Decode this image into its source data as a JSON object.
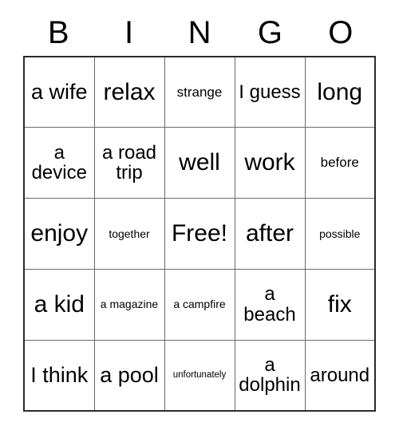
{
  "card": {
    "title_letters": [
      "B",
      "I",
      "N",
      "G",
      "O"
    ],
    "free_space_label": "Free!",
    "rows": [
      [
        {
          "text": "a wife",
          "size": "lg"
        },
        {
          "text": "relax",
          "size": "xl"
        },
        {
          "text": "strange",
          "size": "sm"
        },
        {
          "text": "I guess",
          "size": "md"
        },
        {
          "text": "long",
          "size": "xl"
        }
      ],
      [
        {
          "text": "a device",
          "size": "md"
        },
        {
          "text": "a road trip",
          "size": "md"
        },
        {
          "text": "well",
          "size": "xl"
        },
        {
          "text": "work",
          "size": "xl"
        },
        {
          "text": "before",
          "size": "sm"
        }
      ],
      [
        {
          "text": "enjoy",
          "size": "xl"
        },
        {
          "text": "together",
          "size": "xs"
        },
        {
          "text": "Free!",
          "size": "xl"
        },
        {
          "text": "after",
          "size": "xl"
        },
        {
          "text": "possible",
          "size": "xs"
        }
      ],
      [
        {
          "text": "a kid",
          "size": "xl"
        },
        {
          "text": "a magazine",
          "size": "xs"
        },
        {
          "text": "a campfire",
          "size": "xs"
        },
        {
          "text": "a beach",
          "size": "md"
        },
        {
          "text": "fix",
          "size": "xl"
        }
      ],
      [
        {
          "text": "I think",
          "size": "lg"
        },
        {
          "text": "a pool",
          "size": "lg"
        },
        {
          "text": "unfortunately",
          "size": "xxs"
        },
        {
          "text": "a dolphin",
          "size": "md"
        },
        {
          "text": "around",
          "size": "md"
        }
      ]
    ],
    "colors": {
      "background": "#ffffff",
      "text": "#000000",
      "outer_border": "#2b2b2b",
      "inner_border": "#6a6a6a"
    }
  }
}
